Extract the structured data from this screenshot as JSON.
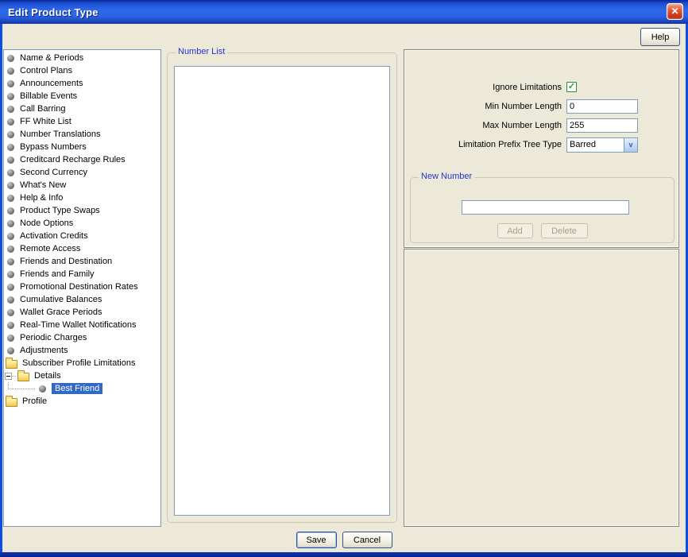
{
  "window": {
    "title": "Edit Product Type"
  },
  "icons": {
    "close": "✕",
    "check": "✓",
    "combo_arrow": "v"
  },
  "help": {
    "label": "Help"
  },
  "tree": {
    "items": [
      {
        "label": "Name & Periods",
        "type": "item",
        "indent": 0
      },
      {
        "label": "Control Plans",
        "type": "item",
        "indent": 0
      },
      {
        "label": "Announcements",
        "type": "item",
        "indent": 0
      },
      {
        "label": "Billable Events",
        "type": "item",
        "indent": 0
      },
      {
        "label": "Call Barring",
        "type": "item",
        "indent": 0
      },
      {
        "label": "FF White List",
        "type": "item",
        "indent": 0
      },
      {
        "label": "Number Translations",
        "type": "item",
        "indent": 0
      },
      {
        "label": "Bypass Numbers",
        "type": "item",
        "indent": 0
      },
      {
        "label": "Creditcard Recharge Rules",
        "type": "item",
        "indent": 0
      },
      {
        "label": "Second Currency",
        "type": "item",
        "indent": 0
      },
      {
        "label": "What's New",
        "type": "item",
        "indent": 0
      },
      {
        "label": "Help & Info",
        "type": "item",
        "indent": 0
      },
      {
        "label": "Product Type Swaps",
        "type": "item",
        "indent": 0
      },
      {
        "label": "Node Options",
        "type": "item",
        "indent": 0
      },
      {
        "label": "Activation Credits",
        "type": "item",
        "indent": 0
      },
      {
        "label": "Remote Access",
        "type": "item",
        "indent": 0
      },
      {
        "label": "Friends and Destination",
        "type": "item",
        "indent": 0
      },
      {
        "label": "Friends and Family",
        "type": "item",
        "indent": 0
      },
      {
        "label": "Promotional Destination Rates",
        "type": "item",
        "indent": 0
      },
      {
        "label": "Cumulative Balances",
        "type": "item",
        "indent": 0
      },
      {
        "label": "Wallet Grace Periods",
        "type": "item",
        "indent": 0
      },
      {
        "label": "Real-Time Wallet Notifications",
        "type": "item",
        "indent": 0
      },
      {
        "label": "Periodic Charges",
        "type": "item",
        "indent": 0
      },
      {
        "label": "Adjustments",
        "type": "item",
        "indent": 0
      },
      {
        "label": "Subscriber Profile Limitations",
        "type": "folder",
        "indent": 0
      },
      {
        "label": "Details",
        "type": "folder",
        "indent": 1,
        "expanded": true
      },
      {
        "label": "Best Friend",
        "type": "item",
        "indent": 2,
        "selected": true
      },
      {
        "label": "Profile",
        "type": "folder",
        "indent": 0
      }
    ]
  },
  "number_list": {
    "title": "Number List",
    "items": []
  },
  "details_form": {
    "ignore_limitations": {
      "label": "Ignore Limitations",
      "checked": true
    },
    "min_number_length": {
      "label": "Min Number Length",
      "value": "0"
    },
    "max_number_length": {
      "label": "Max Number Length",
      "value": "255"
    },
    "limitation_prefix_tree_type": {
      "label": "Limitation Prefix Tree Type",
      "value": "Barred"
    }
  },
  "new_number": {
    "title": "New Number",
    "input_value": "",
    "add_label": "Add",
    "delete_label": "Delete"
  },
  "footer": {
    "save_label": "Save",
    "cancel_label": "Cancel"
  },
  "colors": {
    "selection": "#316AC5",
    "groupbox_label": "#2333CE",
    "window_border": "#0A4FE4",
    "check_green": "#21A121",
    "disabled_text": "#A39F86"
  }
}
